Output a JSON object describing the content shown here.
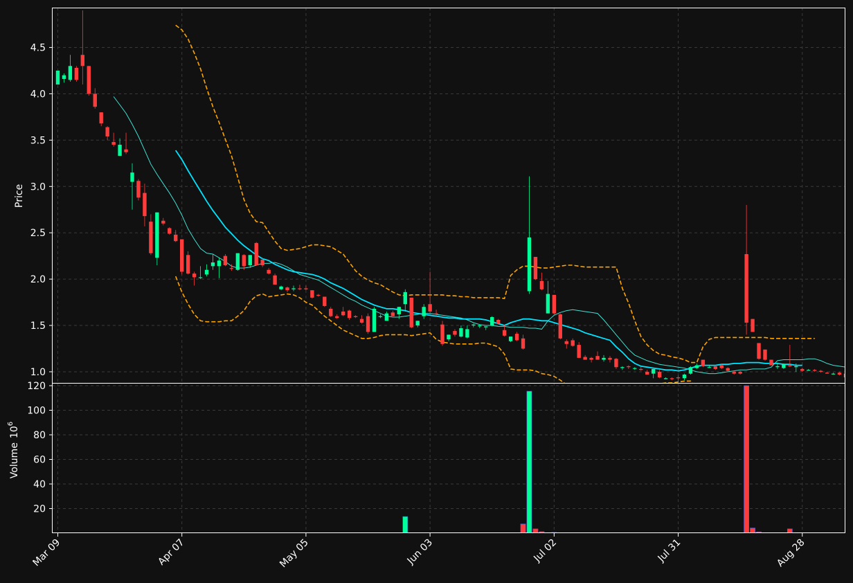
{
  "chart_data": {
    "type": "candlestick",
    "theme": {
      "background": "#111111",
      "up_color": "#00ff99",
      "down_color": "#ff3c3c",
      "ma_fast_color": "#40e0d0",
      "ma_slow_color": "#00e5ff",
      "band_color": "#ffa500",
      "grid": true
    },
    "price_panel": {
      "ylabel": "Price",
      "ylim": [
        0.88,
        4.93
      ],
      "yticks": [
        1.0,
        1.5,
        2.0,
        2.5,
        3.0,
        3.5,
        4.0,
        4.5
      ]
    },
    "volume_panel": {
      "ylabel": "Volume",
      "ylabel_exponent": "6",
      "ylim": [
        0,
        120
      ],
      "yticks": [
        20,
        40,
        60,
        80,
        100,
        120
      ]
    },
    "xticks": [
      {
        "label": "Mar 09",
        "index": 0
      },
      {
        "label": "Apr 07",
        "index": 20
      },
      {
        "label": "May 05",
        "index": 40
      },
      {
        "label": "Jun 03",
        "index": 60
      },
      {
        "label": "Jul 02",
        "index": 80
      },
      {
        "label": "Jul 31",
        "index": 100
      },
      {
        "label": "Aug 28",
        "index": 120
      }
    ],
    "n_bars": 127,
    "bars": [
      [
        4.1,
        4.25,
        4.1,
        4.25,
        0
      ],
      [
        4.16,
        4.22,
        4.12,
        4.2,
        0
      ],
      [
        4.15,
        4.42,
        4.13,
        4.3,
        0
      ],
      [
        4.28,
        4.3,
        4.13,
        4.15,
        0
      ],
      [
        4.42,
        4.9,
        4.1,
        4.3,
        0
      ],
      [
        4.3,
        4.3,
        3.98,
        4.0,
        0
      ],
      [
        4.0,
        4.06,
        3.84,
        3.86,
        0
      ],
      [
        3.8,
        3.8,
        3.65,
        3.68,
        0
      ],
      [
        3.64,
        3.65,
        3.5,
        3.54,
        0
      ],
      [
        3.48,
        3.58,
        3.43,
        3.45,
        0
      ],
      [
        3.33,
        3.52,
        3.33,
        3.45,
        0
      ],
      [
        3.4,
        3.58,
        3.35,
        3.37,
        0
      ],
      [
        3.05,
        3.25,
        2.75,
        3.15,
        0
      ],
      [
        3.06,
        3.08,
        2.85,
        2.88,
        0
      ],
      [
        2.93,
        3.03,
        2.57,
        2.68,
        0
      ],
      [
        2.62,
        2.7,
        2.26,
        2.28,
        0
      ],
      [
        2.23,
        2.72,
        2.15,
        2.72,
        0
      ],
      [
        2.63,
        2.66,
        2.58,
        2.6,
        0
      ],
      [
        2.55,
        2.56,
        2.48,
        2.49,
        0
      ],
      [
        2.48,
        2.53,
        2.4,
        2.41,
        0
      ],
      [
        2.43,
        2.43,
        2.05,
        2.08,
        0
      ],
      [
        2.26,
        2.3,
        2.05,
        2.06,
        0
      ],
      [
        2.06,
        2.08,
        1.93,
        2.02,
        0
      ],
      [
        2.02,
        2.14,
        2.0,
        2.02,
        0
      ],
      [
        2.05,
        2.16,
        2.03,
        2.1,
        0
      ],
      [
        2.14,
        2.27,
        2.1,
        2.18,
        0
      ],
      [
        2.14,
        2.23,
        2.01,
        2.2,
        0
      ],
      [
        2.25,
        2.27,
        2.14,
        2.15,
        0
      ],
      [
        2.12,
        2.16,
        2.09,
        2.11,
        0
      ],
      [
        2.1,
        2.27,
        2.09,
        2.28,
        0
      ],
      [
        2.26,
        2.27,
        2.1,
        2.14,
        0
      ],
      [
        2.15,
        2.26,
        2.12,
        2.26,
        0
      ],
      [
        2.39,
        2.4,
        2.15,
        2.15,
        0
      ],
      [
        2.21,
        2.23,
        2.13,
        2.15,
        0
      ],
      [
        2.1,
        2.12,
        2.05,
        2.06,
        0
      ],
      [
        2.04,
        2.06,
        1.95,
        1.94,
        0
      ],
      [
        1.89,
        1.93,
        1.88,
        1.92,
        0
      ],
      [
        1.91,
        1.92,
        1.86,
        1.88,
        0
      ],
      [
        1.89,
        1.93,
        1.87,
        1.9,
        0
      ],
      [
        1.9,
        1.94,
        1.88,
        1.89,
        0
      ],
      [
        1.9,
        1.93,
        1.88,
        1.89,
        0
      ],
      [
        1.88,
        1.88,
        1.79,
        1.8,
        0
      ],
      [
        1.83,
        1.84,
        1.81,
        1.82,
        0
      ],
      [
        1.81,
        1.81,
        1.7,
        1.71,
        0
      ],
      [
        1.68,
        1.7,
        1.59,
        1.6,
        0
      ],
      [
        1.6,
        1.62,
        1.57,
        1.58,
        0
      ],
      [
        1.65,
        1.7,
        1.6,
        1.61,
        0
      ],
      [
        1.66,
        1.67,
        1.56,
        1.58,
        0
      ],
      [
        1.6,
        1.61,
        1.58,
        1.59,
        0
      ],
      [
        1.57,
        1.61,
        1.52,
        1.53,
        0
      ],
      [
        1.6,
        1.63,
        1.41,
        1.43,
        0
      ],
      [
        1.43,
        1.7,
        1.43,
        1.68,
        0
      ],
      [
        1.6,
        1.62,
        1.58,
        1.6,
        0
      ],
      [
        1.55,
        1.65,
        1.55,
        1.63,
        0
      ],
      [
        1.64,
        1.66,
        1.6,
        1.6,
        0
      ],
      [
        1.62,
        1.7,
        1.57,
        1.7,
        0
      ],
      [
        1.73,
        1.89,
        1.65,
        1.86,
        0
      ],
      [
        1.8,
        1.8,
        1.47,
        1.48,
        0
      ],
      [
        1.5,
        1.55,
        1.48,
        1.55,
        0
      ],
      [
        1.6,
        1.73,
        1.57,
        1.7,
        0
      ],
      [
        1.73,
        2.08,
        1.62,
        1.65,
        0
      ],
      [
        1.63,
        1.67,
        1.6,
        1.62,
        0
      ],
      [
        1.51,
        1.55,
        1.28,
        1.3,
        0
      ],
      [
        1.35,
        1.4,
        1.33,
        1.4,
        0
      ],
      [
        1.44,
        1.46,
        1.38,
        1.4,
        0
      ],
      [
        1.38,
        1.5,
        1.37,
        1.47,
        0
      ],
      [
        1.37,
        1.5,
        1.36,
        1.46,
        0
      ],
      [
        1.5,
        1.52,
        1.48,
        1.51,
        0
      ],
      [
        1.5,
        1.51,
        1.47,
        1.5,
        0
      ],
      [
        1.48,
        1.49,
        1.45,
        1.49,
        0
      ],
      [
        1.5,
        1.6,
        1.49,
        1.59,
        0
      ],
      [
        1.56,
        1.57,
        1.52,
        1.52,
        0
      ],
      [
        1.45,
        1.5,
        1.38,
        1.39,
        0
      ],
      [
        1.33,
        1.38,
        1.32,
        1.38,
        0
      ],
      [
        1.41,
        1.43,
        1.33,
        1.34,
        0
      ],
      [
        1.36,
        1.4,
        1.24,
        1.25,
        0
      ],
      [
        1.87,
        3.11,
        1.84,
        2.45,
        115.5
      ],
      [
        2.24,
        2.24,
        1.99,
        2.0,
        3.5
      ],
      [
        1.98,
        2.07,
        1.88,
        1.89,
        1.2
      ],
      [
        1.63,
        1.98,
        1.63,
        1.84,
        0
      ],
      [
        1.83,
        1.83,
        1.62,
        1.63,
        0.6
      ],
      [
        1.62,
        1.63,
        1.35,
        1.36,
        0
      ],
      [
        1.33,
        1.35,
        1.25,
        1.3,
        0
      ],
      [
        1.34,
        1.36,
        1.27,
        1.28,
        0
      ],
      [
        1.29,
        1.32,
        1.15,
        1.15,
        0
      ],
      [
        1.16,
        1.18,
        1.13,
        1.13,
        0
      ],
      [
        1.15,
        1.16,
        1.1,
        1.13,
        0
      ],
      [
        1.17,
        1.22,
        1.14,
        1.13,
        0
      ],
      [
        1.13,
        1.18,
        1.11,
        1.15,
        0
      ],
      [
        1.15,
        1.17,
        1.1,
        1.13,
        0
      ],
      [
        1.14,
        1.15,
        1.03,
        1.05,
        0
      ],
      [
        1.04,
        1.06,
        1.02,
        1.05,
        0
      ],
      [
        1.06,
        1.07,
        1.03,
        1.05,
        0
      ],
      [
        1.04,
        1.05,
        1.02,
        1.04,
        0
      ],
      [
        1.03,
        1.06,
        1.01,
        1.02,
        0
      ],
      [
        1.0,
        1.02,
        0.97,
        0.97,
        0
      ],
      [
        0.98,
        1.03,
        0.93,
        1.03,
        0
      ],
      [
        1.0,
        1.02,
        0.93,
        0.94,
        0
      ],
      [
        0.92,
        0.94,
        0.92,
        0.93,
        0
      ],
      [
        0.93,
        0.94,
        0.91,
        0.92,
        0
      ],
      [
        0.94,
        0.96,
        0.9,
        0.93,
        0
      ],
      [
        0.93,
        0.98,
        0.91,
        0.97,
        0
      ],
      [
        0.98,
        1.06,
        0.97,
        1.05,
        0
      ],
      [
        1.04,
        1.09,
        1.03,
        1.07,
        0
      ],
      [
        1.13,
        1.13,
        1.05,
        1.06,
        0
      ],
      [
        1.05,
        1.07,
        1.04,
        1.05,
        0
      ],
      [
        1.06,
        1.07,
        1.02,
        1.03,
        0
      ],
      [
        1.07,
        1.08,
        1.03,
        1.04,
        0
      ],
      [
        1.04,
        1.05,
        1.0,
        1.01,
        0
      ],
      [
        1.0,
        1.01,
        0.97,
        0.98,
        0
      ],
      [
        1.0,
        1.01,
        0.97,
        0.98,
        0
      ],
      [
        2.27,
        2.8,
        1.4,
        1.53,
        120
      ],
      [
        1.57,
        1.57,
        1.43,
        1.43,
        4.2
      ],
      [
        1.31,
        1.31,
        1.13,
        1.14,
        1.0
      ],
      [
        1.24,
        1.24,
        1.12,
        1.13,
        0
      ],
      [
        1.13,
        1.13,
        1.07,
        1.07,
        0
      ],
      [
        1.05,
        1.1,
        1.03,
        1.06,
        0
      ],
      [
        1.04,
        1.09,
        1.03,
        1.08,
        0
      ],
      [
        1.07,
        1.29,
        1.05,
        1.06,
        3.5
      ],
      [
        1.05,
        1.09,
        1.0,
        1.06,
        0
      ],
      [
        1.03,
        1.04,
        1.0,
        1.01,
        0
      ],
      [
        1.02,
        1.03,
        1.01,
        1.02,
        0
      ],
      [
        1.02,
        1.03,
        1.0,
        1.01,
        0
      ],
      [
        1.01,
        1.02,
        0.99,
        1.0,
        0
      ],
      [
        0.99,
        1.0,
        0.98,
        0.98,
        0
      ],
      [
        0.98,
        0.99,
        0.97,
        0.98,
        0
      ],
      [
        0.99,
        1.0,
        0.96,
        0.97,
        0
      ],
      [
        0.98,
        0.98,
        0.94,
        0.94,
        0
      ]
    ],
    "extra_volume": [
      {
        "index": 56,
        "value": 13.5,
        "dir": "up"
      },
      {
        "index": 75,
        "value": 7.5,
        "dir": "down"
      }
    ],
    "ma_fast": {
      "start": 9,
      "values": [
        3.97,
        3.88,
        3.79,
        3.67,
        3.54,
        3.39,
        3.24,
        3.13,
        3.03,
        2.93,
        2.82,
        2.69,
        2.54,
        2.43,
        2.33,
        2.28,
        2.27,
        2.23,
        2.19,
        2.14,
        2.12,
        2.12,
        2.13,
        2.15,
        2.17,
        2.17,
        2.18,
        2.16,
        2.13,
        2.09,
        2.05,
        2.03,
        2.01,
        1.99,
        1.95,
        1.91,
        1.87,
        1.83,
        1.79,
        1.76,
        1.72,
        1.69,
        1.66,
        1.63,
        1.6,
        1.59,
        1.59,
        1.6,
        1.61,
        1.62,
        1.63,
        1.63,
        1.62,
        1.61,
        1.6,
        1.59,
        1.58,
        1.56,
        1.53,
        1.51,
        1.5,
        1.5,
        1.49,
        1.49,
        1.48,
        1.48,
        1.48,
        1.47,
        1.47,
        1.46,
        1.55,
        1.61,
        1.64,
        1.66,
        1.67,
        1.66,
        1.65,
        1.64,
        1.63,
        1.56,
        1.48,
        1.4,
        1.32,
        1.24,
        1.18,
        1.15,
        1.12,
        1.1,
        1.08,
        1.07,
        1.06,
        1.05,
        1.04,
        1.02,
        1.0,
        0.99,
        0.98,
        0.98,
        0.99,
        1.0,
        1.01,
        1.02,
        1.02,
        1.03,
        1.03,
        1.03,
        1.05,
        1.12,
        1.13,
        1.13,
        1.13,
        1.13,
        1.14,
        1.14,
        1.12,
        1.09,
        1.07,
        1.06,
        1.05,
        1.04
      ]
    },
    "ma_slow": {
      "start": 19,
      "values": [
        3.39,
        3.29,
        3.17,
        3.06,
        2.95,
        2.84,
        2.74,
        2.65,
        2.56,
        2.49,
        2.42,
        2.36,
        2.31,
        2.26,
        2.22,
        2.2,
        2.16,
        2.13,
        2.1,
        2.08,
        2.07,
        2.06,
        2.05,
        2.03,
        2.0,
        1.96,
        1.93,
        1.9,
        1.86,
        1.82,
        1.78,
        1.75,
        1.72,
        1.7,
        1.68,
        1.68,
        1.67,
        1.66,
        1.64,
        1.63,
        1.62,
        1.61,
        1.6,
        1.59,
        1.58,
        1.58,
        1.57,
        1.57,
        1.57,
        1.57,
        1.56,
        1.54,
        1.52,
        1.5,
        1.53,
        1.55,
        1.57,
        1.57,
        1.56,
        1.55,
        1.55,
        1.53,
        1.51,
        1.49,
        1.47,
        1.45,
        1.42,
        1.4,
        1.38,
        1.36,
        1.34,
        1.27,
        1.21,
        1.14,
        1.09,
        1.06,
        1.05,
        1.04,
        1.03,
        1.02,
        1.02,
        1.01,
        1.02,
        1.04,
        1.06,
        1.07,
        1.07,
        1.07,
        1.08,
        1.08,
        1.09,
        1.09,
        1.1,
        1.1,
        1.1,
        1.09,
        1.09,
        1.09,
        1.08,
        1.08,
        1.07,
        1.07
      ]
    },
    "band_upper": {
      "start": 19,
      "values": [
        4.74,
        4.69,
        4.59,
        4.44,
        4.27,
        4.06,
        3.86,
        3.69,
        3.51,
        3.33,
        3.1,
        2.86,
        2.71,
        2.62,
        2.61,
        2.51,
        2.41,
        2.33,
        2.31,
        2.32,
        2.33,
        2.35,
        2.37,
        2.37,
        2.36,
        2.35,
        2.31,
        2.27,
        2.18,
        2.09,
        2.03,
        1.99,
        1.96,
        1.94,
        1.9,
        1.86,
        1.83,
        1.82,
        1.83,
        1.83,
        1.83,
        1.83,
        1.83,
        1.83,
        1.82,
        1.82,
        1.81,
        1.81,
        1.8,
        1.8,
        1.8,
        1.8,
        1.8,
        1.79,
        2.04,
        2.1,
        2.14,
        2.14,
        2.13,
        2.12,
        2.12,
        2.13,
        2.14,
        2.15,
        2.15,
        2.14,
        2.13,
        2.13,
        2.13,
        2.13,
        2.13,
        2.13,
        1.9,
        1.74,
        1.55,
        1.38,
        1.29,
        1.23,
        1.19,
        1.18,
        1.16,
        1.15,
        1.13,
        1.1,
        1.1,
        1.27,
        1.35,
        1.37,
        1.37,
        1.37,
        1.37,
        1.37,
        1.37,
        1.37,
        1.37,
        1.37,
        1.36,
        1.36,
        1.36,
        1.36,
        1.36,
        1.36,
        1.36,
        1.36
      ]
    },
    "band_lower": {
      "start": 19,
      "values": [
        2.03,
        1.86,
        1.73,
        1.62,
        1.55,
        1.54,
        1.54,
        1.54,
        1.55,
        1.55,
        1.6,
        1.66,
        1.76,
        1.82,
        1.84,
        1.81,
        1.82,
        1.83,
        1.84,
        1.83,
        1.8,
        1.75,
        1.72,
        1.66,
        1.6,
        1.55,
        1.5,
        1.45,
        1.42,
        1.39,
        1.36,
        1.36,
        1.37,
        1.39,
        1.4,
        1.4,
        1.4,
        1.4,
        1.39,
        1.4,
        1.41,
        1.42,
        1.35,
        1.32,
        1.31,
        1.3,
        1.3,
        1.3,
        1.3,
        1.31,
        1.31,
        1.29,
        1.27,
        1.19,
        1.03,
        1.02,
        1.02,
        1.02,
        1.01,
        0.98,
        0.97,
        0.95,
        0.91,
        0.86,
        0.81,
        0.76,
        0.71,
        0.66,
        0.61,
        0.57,
        0.52,
        0.48,
        0.44,
        0.41,
        0.79,
        0.84,
        0.86,
        0.87,
        0.87,
        0.88,
        0.88,
        0.89,
        0.9,
        0.9,
        0.81,
        0.72,
        0.7,
        0.7,
        0.7,
        0.7,
        0.7,
        0.7,
        0.7,
        0.7,
        0.7,
        0.7,
        0.7,
        0.7,
        0.7,
        0.7,
        0.7,
        0.7,
        0.7
      ]
    }
  }
}
